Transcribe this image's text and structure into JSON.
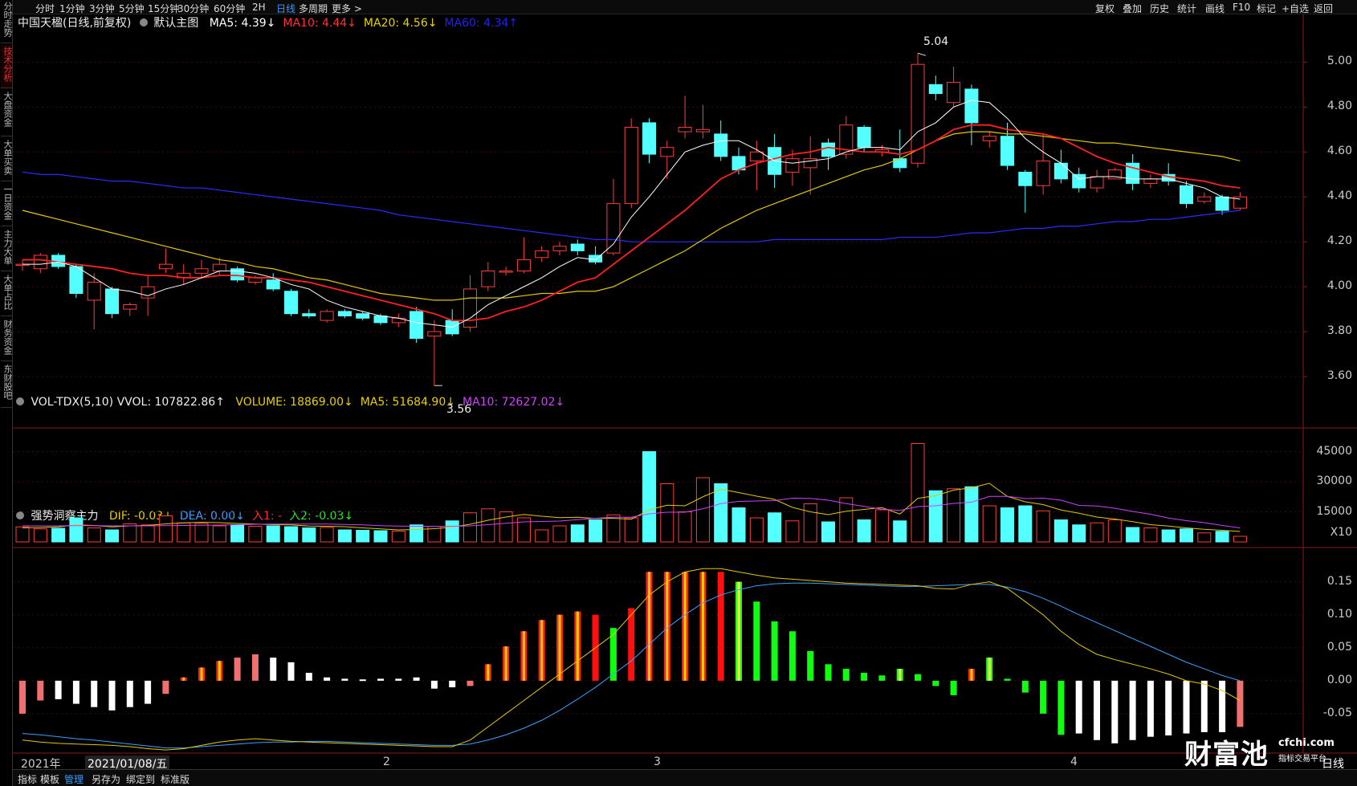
{
  "side_tabs": [
    {
      "label": "分时走势",
      "active": false
    },
    {
      "label": "技术分析",
      "active": true
    },
    {
      "label": "大盘资金",
      "active": false
    },
    {
      "label": "大单买卖",
      "active": false
    },
    {
      "label": "一日资金",
      "active": false
    },
    {
      "label": "主力大单",
      "active": false
    },
    {
      "label": "大单占比",
      "active": false
    },
    {
      "label": "财务资金",
      "active": false
    },
    {
      "label": "东财股吧",
      "active": false
    }
  ],
  "periods": [
    "分时",
    "1分钟",
    "3分钟",
    "5分钟",
    "15分钟",
    "30分钟",
    "60分钟",
    "2H",
    "日线",
    "多周期",
    "更多 >"
  ],
  "active_period": "日线",
  "tools": [
    "复权",
    "叠加",
    "历史",
    "统计",
    "画线",
    "F10",
    "标记",
    "+自选",
    "返回"
  ],
  "main_header": {
    "title": "中国天楹(日线,前复权)",
    "template": "默认主图",
    "indicators": [
      {
        "text": "MA5: 4.39↓",
        "color": "#ffffff"
      },
      {
        "text": "MA10: 4.44↓",
        "color": "#ff3030"
      },
      {
        "text": "MA20: 4.56↓",
        "color": "#e8d000"
      },
      {
        "text": "MA60: 4.34↑",
        "color": "#2020ff"
      }
    ]
  },
  "vol_header": {
    "title": "VOL-TDX(5,10) VVOL: 107822.86↑",
    "indicators": [
      {
        "text": "VOLUME: 18869.00↓",
        "color": "#e8d000"
      },
      {
        "text": "MA5: 51684.90↓",
        "color": "#e8d000"
      },
      {
        "text": "MA10: 72627.02↓",
        "color": "#d040ff"
      }
    ]
  },
  "macd_header": {
    "title": "强势洞察主力",
    "indicators": [
      {
        "text": "DIF: -0.03↓",
        "color": "#e8d000"
      },
      {
        "text": "DEA: 0.00↓",
        "color": "#3aa0ff"
      },
      {
        "text": "入1: -",
        "color": "#ff3030"
      },
      {
        "text": "入2: -0.03↓",
        "color": "#30e030"
      }
    ]
  },
  "price_axis": [
    "5.00",
    "4.80",
    "4.60",
    "4.40",
    "4.20",
    "4.00",
    "3.80",
    "3.60"
  ],
  "vol_axis": [
    "45000",
    "30000",
    "15000",
    "X10"
  ],
  "macd_axis": [
    "0.15",
    "0.10",
    "0.05",
    "0.00",
    "-0.05"
  ],
  "price_marks": {
    "high": "5.04",
    "low": "3.56"
  },
  "x_labels": [
    "2021年",
    "2021/01/08/五",
    "2",
    "3",
    "4"
  ],
  "period_label": "日线",
  "bottom_tools": [
    "指标",
    "模板",
    "管理",
    "另存为",
    "绑定到",
    "标准版"
  ],
  "active_bottom_tool": "管理",
  "watermark": {
    "brand": "财富池",
    "site": "cfchi.com",
    "tagline": "指标交易平台"
  },
  "chart_data": {
    "type": "candlestick",
    "ylim": [
      3.5,
      5.08
    ],
    "candles": [
      {
        "o": 4.1,
        "h": 4.12,
        "l": 4.07,
        "c": 4.1
      },
      {
        "o": 4.08,
        "h": 4.15,
        "l": 4.06,
        "c": 4.14
      },
      {
        "o": 4.14,
        "h": 4.15,
        "l": 4.08,
        "c": 4.09
      },
      {
        "o": 4.09,
        "h": 4.1,
        "l": 3.95,
        "c": 3.97
      },
      {
        "o": 3.94,
        "h": 4.06,
        "l": 3.81,
        "c": 4.02
      },
      {
        "o": 3.99,
        "h": 4.0,
        "l": 3.86,
        "c": 3.88
      },
      {
        "o": 3.9,
        "h": 3.93,
        "l": 3.87,
        "c": 3.92
      },
      {
        "o": 3.95,
        "h": 4.05,
        "l": 3.87,
        "c": 4.0
      },
      {
        "o": 4.08,
        "h": 4.17,
        "l": 4.06,
        "c": 4.1
      },
      {
        "o": 4.04,
        "h": 4.1,
        "l": 4.01,
        "c": 4.06
      },
      {
        "o": 4.06,
        "h": 4.12,
        "l": 4.04,
        "c": 4.08
      },
      {
        "o": 4.07,
        "h": 4.13,
        "l": 4.05,
        "c": 4.1
      },
      {
        "o": 4.08,
        "h": 4.09,
        "l": 4.02,
        "c": 4.03
      },
      {
        "o": 4.02,
        "h": 4.05,
        "l": 4.01,
        "c": 4.04
      },
      {
        "o": 4.03,
        "h": 4.06,
        "l": 3.98,
        "c": 3.99
      },
      {
        "o": 3.98,
        "h": 3.99,
        "l": 3.87,
        "c": 3.88
      },
      {
        "o": 3.88,
        "h": 3.9,
        "l": 3.86,
        "c": 3.87
      },
      {
        "o": 3.85,
        "h": 3.9,
        "l": 3.84,
        "c": 3.89
      },
      {
        "o": 3.89,
        "h": 3.9,
        "l": 3.86,
        "c": 3.87
      },
      {
        "o": 3.88,
        "h": 3.89,
        "l": 3.85,
        "c": 3.86
      },
      {
        "o": 3.87,
        "h": 3.88,
        "l": 3.83,
        "c": 3.84
      },
      {
        "o": 3.84,
        "h": 3.88,
        "l": 3.82,
        "c": 3.86
      },
      {
        "o": 3.89,
        "h": 3.91,
        "l": 3.75,
        "c": 3.77
      },
      {
        "o": 3.78,
        "h": 3.85,
        "l": 3.56,
        "c": 3.8
      },
      {
        "o": 3.85,
        "h": 3.9,
        "l": 3.78,
        "c": 3.79
      },
      {
        "o": 3.82,
        "h": 4.05,
        "l": 3.8,
        "c": 3.99
      },
      {
        "o": 4.0,
        "h": 4.11,
        "l": 3.98,
        "c": 4.07
      },
      {
        "o": 4.07,
        "h": 4.09,
        "l": 4.05,
        "c": 4.07
      },
      {
        "o": 4.07,
        "h": 4.22,
        "l": 4.06,
        "c": 4.12
      },
      {
        "o": 4.13,
        "h": 4.18,
        "l": 4.11,
        "c": 4.16
      },
      {
        "o": 4.16,
        "h": 4.2,
        "l": 4.14,
        "c": 4.18
      },
      {
        "o": 4.19,
        "h": 4.21,
        "l": 4.14,
        "c": 4.16
      },
      {
        "o": 4.14,
        "h": 4.18,
        "l": 4.1,
        "c": 4.11
      },
      {
        "o": 4.15,
        "h": 4.48,
        "l": 4.14,
        "c": 4.37
      },
      {
        "o": 4.37,
        "h": 4.75,
        "l": 4.35,
        "c": 4.71
      },
      {
        "o": 4.73,
        "h": 4.75,
        "l": 4.55,
        "c": 4.59
      },
      {
        "o": 4.58,
        "h": 4.65,
        "l": 4.48,
        "c": 4.62
      },
      {
        "o": 4.69,
        "h": 4.85,
        "l": 4.66,
        "c": 4.71
      },
      {
        "o": 4.69,
        "h": 4.81,
        "l": 4.66,
        "c": 4.7
      },
      {
        "o": 4.68,
        "h": 4.74,
        "l": 4.56,
        "c": 4.58
      },
      {
        "o": 4.58,
        "h": 4.62,
        "l": 4.5,
        "c": 4.52
      },
      {
        "o": 4.56,
        "h": 4.65,
        "l": 4.43,
        "c": 4.6
      },
      {
        "o": 4.62,
        "h": 4.68,
        "l": 4.44,
        "c": 4.5
      },
      {
        "o": 4.51,
        "h": 4.61,
        "l": 4.45,
        "c": 4.57
      },
      {
        "o": 4.53,
        "h": 4.67,
        "l": 4.41,
        "c": 4.57
      },
      {
        "o": 4.64,
        "h": 4.66,
        "l": 4.52,
        "c": 4.58
      },
      {
        "o": 4.59,
        "h": 4.76,
        "l": 4.57,
        "c": 4.72
      },
      {
        "o": 4.71,
        "h": 4.72,
        "l": 4.6,
        "c": 4.62
      },
      {
        "o": 4.6,
        "h": 4.63,
        "l": 4.58,
        "c": 4.61
      },
      {
        "o": 4.57,
        "h": 4.7,
        "l": 4.51,
        "c": 4.53
      },
      {
        "o": 4.55,
        "h": 5.04,
        "l": 4.53,
        "c": 4.99
      },
      {
        "o": 4.9,
        "h": 4.94,
        "l": 4.83,
        "c": 4.86
      },
      {
        "o": 4.82,
        "h": 4.98,
        "l": 4.8,
        "c": 4.91
      },
      {
        "o": 4.88,
        "h": 4.9,
        "l": 4.63,
        "c": 4.73
      },
      {
        "o": 4.65,
        "h": 4.69,
        "l": 4.62,
        "c": 4.67
      },
      {
        "o": 4.67,
        "h": 4.73,
        "l": 4.52,
        "c": 4.54
      },
      {
        "o": 4.51,
        "h": 4.52,
        "l": 4.33,
        "c": 4.45
      },
      {
        "o": 4.45,
        "h": 4.68,
        "l": 4.41,
        "c": 4.56
      },
      {
        "o": 4.55,
        "h": 4.61,
        "l": 4.46,
        "c": 4.48
      },
      {
        "o": 4.5,
        "h": 4.53,
        "l": 4.42,
        "c": 4.44
      },
      {
        "o": 4.44,
        "h": 4.52,
        "l": 4.42,
        "c": 4.49
      },
      {
        "o": 4.48,
        "h": 4.53,
        "l": 4.48,
        "c": 4.52
      },
      {
        "o": 4.55,
        "h": 4.59,
        "l": 4.43,
        "c": 4.46
      },
      {
        "o": 4.46,
        "h": 4.5,
        "l": 4.44,
        "c": 4.48
      },
      {
        "o": 4.5,
        "h": 4.55,
        "l": 4.45,
        "c": 4.47
      },
      {
        "o": 4.45,
        "h": 4.47,
        "l": 4.35,
        "c": 4.37
      },
      {
        "o": 4.38,
        "h": 4.42,
        "l": 4.37,
        "c": 4.4
      },
      {
        "o": 4.4,
        "h": 4.41,
        "l": 4.32,
        "c": 4.34
      },
      {
        "o": 4.35,
        "h": 4.42,
        "l": 4.34,
        "c": 4.4
      }
    ],
    "ma5": [
      4.1,
      4.1,
      4.11,
      4.09,
      4.04,
      3.99,
      3.98,
      3.96,
      3.99,
      4.01,
      4.04,
      4.07,
      4.07,
      4.06,
      4.04,
      4.01,
      3.99,
      3.94,
      3.91,
      3.89,
      3.87,
      3.86,
      3.84,
      3.83,
      3.82,
      3.86,
      3.92,
      3.96,
      4.0,
      4.04,
      4.09,
      4.13,
      4.12,
      4.19,
      4.31,
      4.4,
      4.5,
      4.6,
      4.63,
      4.65,
      4.65,
      4.61,
      4.56,
      4.55,
      4.56,
      4.57,
      4.6,
      4.62,
      4.62,
      4.61,
      4.69,
      4.73,
      4.8,
      4.83,
      4.82,
      4.75,
      4.66,
      4.6,
      4.55,
      4.48,
      4.49,
      4.49,
      4.48,
      4.48,
      4.48,
      4.46,
      4.44,
      4.4,
      4.39
    ],
    "ma10": [
      4.12,
      4.12,
      4.11,
      4.1,
      4.09,
      4.08,
      4.06,
      4.05,
      4.05,
      4.04,
      4.04,
      4.05,
      4.05,
      4.04,
      4.04,
      4.03,
      4.02,
      4.0,
      3.98,
      3.96,
      3.94,
      3.92,
      3.9,
      3.88,
      3.85,
      3.85,
      3.86,
      3.89,
      3.91,
      3.94,
      3.98,
      4.02,
      4.04,
      4.1,
      4.16,
      4.22,
      4.28,
      4.34,
      4.41,
      4.48,
      4.52,
      4.55,
      4.57,
      4.59,
      4.6,
      4.62,
      4.61,
      4.6,
      4.6,
      4.59,
      4.61,
      4.65,
      4.7,
      4.72,
      4.72,
      4.7,
      4.69,
      4.68,
      4.66,
      4.62,
      4.58,
      4.55,
      4.53,
      4.51,
      4.49,
      4.48,
      4.47,
      4.45,
      4.44
    ],
    "ma20": [
      4.34,
      4.32,
      4.3,
      4.28,
      4.26,
      4.24,
      4.22,
      4.2,
      4.18,
      4.16,
      4.14,
      4.12,
      4.11,
      4.09,
      4.08,
      4.06,
      4.04,
      4.03,
      4.01,
      3.99,
      3.97,
      3.96,
      3.95,
      3.94,
      3.94,
      3.95,
      3.95,
      3.95,
      3.96,
      3.97,
      3.97,
      3.98,
      3.98,
      4.0,
      4.04,
      4.08,
      4.12,
      4.16,
      4.21,
      4.26,
      4.3,
      4.34,
      4.37,
      4.4,
      4.43,
      4.46,
      4.49,
      4.52,
      4.54,
      4.57,
      4.61,
      4.65,
      4.68,
      4.69,
      4.69,
      4.68,
      4.68,
      4.67,
      4.66,
      4.65,
      4.64,
      4.64,
      4.63,
      4.62,
      4.61,
      4.6,
      4.59,
      4.58,
      4.56
    ],
    "ma60": [
      4.51,
      4.5,
      4.5,
      4.49,
      4.48,
      4.47,
      4.47,
      4.46,
      4.45,
      4.44,
      4.44,
      4.43,
      4.42,
      4.41,
      4.4,
      4.39,
      4.38,
      4.37,
      4.36,
      4.35,
      4.34,
      4.32,
      4.31,
      4.3,
      4.29,
      4.28,
      4.27,
      4.26,
      4.25,
      4.24,
      4.23,
      4.22,
      4.21,
      4.21,
      4.2,
      4.2,
      4.2,
      4.2,
      4.2,
      4.2,
      4.2,
      4.2,
      4.21,
      4.21,
      4.21,
      4.21,
      4.21,
      4.21,
      4.21,
      4.22,
      4.22,
      4.22,
      4.23,
      4.24,
      4.24,
      4.25,
      4.26,
      4.26,
      4.27,
      4.27,
      4.28,
      4.29,
      4.29,
      4.3,
      4.3,
      4.31,
      4.32,
      4.33,
      4.34
    ],
    "volume": {
      "ylim": [
        0,
        52000
      ],
      "values": [
        7500,
        6500,
        6800,
        12000,
        7000,
        6000,
        9000,
        8500,
        13000,
        9500,
        9200,
        8000,
        8500,
        7800,
        8000,
        7600,
        7000,
        7200,
        6000,
        5800,
        5600,
        5400,
        8500,
        7800,
        10500,
        14500,
        16500,
        15000,
        12000,
        6000,
        8000,
        8500,
        11000,
        13500,
        12000,
        45000,
        29000,
        15000,
        32000,
        29000,
        17000,
        12000,
        14500,
        10500,
        19000,
        10000,
        22000,
        11000,
        16000,
        10500,
        49000,
        25500,
        26500,
        27500,
        18000,
        17000,
        18000,
        15500,
        11000,
        8500,
        9500,
        11000,
        7200,
        7000,
        6000,
        6500,
        4500,
        5300,
        2800
      ],
      "ma5": [
        7000,
        7200,
        7500,
        8500,
        8200,
        7500,
        8000,
        8200,
        9000,
        9500,
        9800,
        9600,
        9200,
        8900,
        8600,
        8500,
        7900,
        7800,
        7600,
        7000,
        6500,
        6000,
        6200,
        6600,
        7400,
        8800,
        10800,
        12400,
        13700,
        12800,
        12100,
        12300,
        11700,
        11800,
        11300,
        16000,
        18300,
        18000,
        22500,
        26300,
        24600,
        22800,
        21200,
        17200,
        15000,
        13600,
        15300,
        16200,
        17100,
        13900,
        21700,
        23100,
        25800,
        27000,
        29200,
        22700,
        20000,
        18600,
        15900,
        14300,
        12400,
        11400,
        10100,
        8600,
        7900,
        7000,
        6300,
        5800,
        5200
      ],
      "ma10": [
        8000,
        8000,
        8000,
        8100,
        8100,
        8000,
        8000,
        8000,
        8100,
        8200,
        8300,
        8400,
        8600,
        8800,
        8900,
        8900,
        8900,
        8900,
        8700,
        8500,
        8100,
        7900,
        7800,
        7800,
        7800,
        8000,
        8600,
        9300,
        10000,
        10200,
        10400,
        11100,
        11800,
        12300,
        12300,
        14000,
        14800,
        14800,
        16500,
        19100,
        20200,
        20400,
        20600,
        21800,
        21700,
        20800,
        19100,
        17700,
        16300,
        15700,
        17600,
        18000,
        19200,
        19800,
        22700,
        22700,
        21600,
        21800,
        20800,
        18200,
        17900,
        16800,
        15200,
        13800,
        11900,
        10600,
        9600,
        8200,
        7000
      ]
    },
    "macd": {
      "ylim": [
        -0.1,
        0.18
      ],
      "hist": [
        -0.05,
        -0.03,
        -0.028,
        -0.035,
        -0.04,
        -0.045,
        -0.04,
        -0.035,
        -0.02,
        0.005,
        0.02,
        0.03,
        0.035,
        0.04,
        0.035,
        0.028,
        0.012,
        0.005,
        0.003,
        0.002,
        0.003,
        0.003,
        0.005,
        -0.012,
        -0.01,
        -0.008,
        0.025,
        0.052,
        0.075,
        0.092,
        0.1,
        0.105,
        0.1,
        0.08,
        0.11,
        0.165,
        0.165,
        0.165,
        0.165,
        0.165,
        0.15,
        0.12,
        0.09,
        0.075,
        0.045,
        0.025,
        0.018,
        0.012,
        0.008,
        0.018,
        0.01,
        -0.008,
        -0.022,
        0.018,
        0.035,
        0.003,
        -0.018,
        -0.05,
        -0.082,
        -0.08,
        -0.09,
        -0.095,
        -0.09,
        -0.085,
        -0.083,
        -0.08,
        -0.078,
        -0.078,
        -0.07
      ],
      "hist_style": [
        "pink",
        "pink",
        "white",
        "white",
        "white",
        "white",
        "white",
        "white",
        "pink",
        "ry",
        "ry",
        "ry",
        "pink",
        "pink",
        "white",
        "white",
        "white",
        "white",
        "white",
        "white",
        "white",
        "white",
        "white",
        "white",
        "white",
        "pink",
        "ry",
        "ry",
        "ry",
        "ry",
        "ry",
        "ry",
        "red",
        "green",
        "red",
        "ry",
        "ry",
        "ry",
        "ry",
        "red",
        "gy",
        "green",
        "green",
        "green",
        "green",
        "green",
        "green",
        "green",
        "green",
        "gy",
        "green",
        "green",
        "green",
        "ry",
        "gy",
        "green",
        "green",
        "green",
        "green",
        "white",
        "white",
        "white",
        "white",
        "white",
        "white",
        "white",
        "white",
        "white",
        "pink"
      ],
      "dif": [
        -0.09,
        -0.093,
        -0.095,
        -0.096,
        -0.097,
        -0.098,
        -0.1,
        -0.103,
        -0.105,
        -0.103,
        -0.098,
        -0.093,
        -0.09,
        -0.088,
        -0.09,
        -0.092,
        -0.093,
        -0.094,
        -0.095,
        -0.096,
        -0.097,
        -0.098,
        -0.099,
        -0.1,
        -0.1,
        -0.09,
        -0.07,
        -0.05,
        -0.03,
        -0.01,
        0.01,
        0.03,
        0.05,
        0.07,
        0.1,
        0.13,
        0.15,
        0.165,
        0.17,
        0.17,
        0.165,
        0.16,
        0.156,
        0.154,
        0.152,
        0.15,
        0.148,
        0.147,
        0.146,
        0.145,
        0.144,
        0.14,
        0.139,
        0.146,
        0.15,
        0.14,
        0.12,
        0.1,
        0.075,
        0.055,
        0.04,
        0.032,
        0.025,
        0.018,
        0.01,
        0.0,
        -0.005,
        -0.015,
        -0.03
      ],
      "dea": [
        -0.08,
        -0.082,
        -0.085,
        -0.088,
        -0.09,
        -0.093,
        -0.096,
        -0.099,
        -0.102,
        -0.102,
        -0.1,
        -0.098,
        -0.096,
        -0.094,
        -0.093,
        -0.093,
        -0.092,
        -0.092,
        -0.093,
        -0.094,
        -0.095,
        -0.096,
        -0.097,
        -0.098,
        -0.098,
        -0.096,
        -0.09,
        -0.082,
        -0.072,
        -0.06,
        -0.045,
        -0.028,
        -0.01,
        0.01,
        0.03,
        0.055,
        0.08,
        0.1,
        0.118,
        0.13,
        0.138,
        0.144,
        0.147,
        0.148,
        0.148,
        0.147,
        0.146,
        0.145,
        0.144,
        0.143,
        0.143,
        0.144,
        0.145,
        0.146,
        0.146,
        0.142,
        0.135,
        0.125,
        0.113,
        0.1,
        0.088,
        0.076,
        0.064,
        0.052,
        0.04,
        0.028,
        0.018,
        0.008,
        0.0
      ]
    }
  }
}
